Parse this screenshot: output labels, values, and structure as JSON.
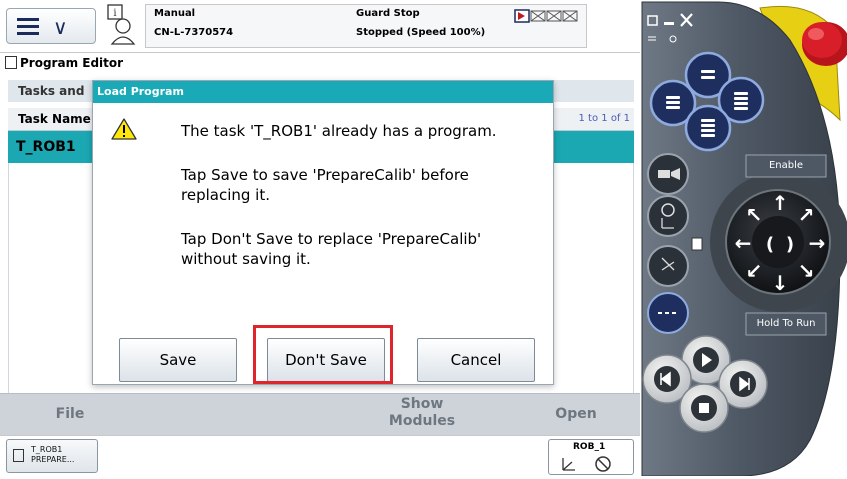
{
  "status_bar": {
    "mode": "Manual",
    "controller": "CN-L-7370574",
    "state": "Guard Stop",
    "speed": "Stopped (Speed 100%)"
  },
  "app": {
    "title": "Program Editor"
  },
  "tasks": {
    "header": "Tasks and",
    "column_header": "Task Name",
    "count": "1 to 1 of 1",
    "rows": [
      {
        "name": "T_ROB1"
      }
    ]
  },
  "dialog": {
    "title": "Load Program",
    "line1": "The task 'T_ROB1' already has a program.",
    "line2a": "Tap Save to save 'PrepareCalib' before",
    "line2b": "replacing it.",
    "line3a": "Tap Don't Save to replace 'PrepareCalib'",
    "line3b": "without saving it.",
    "buttons": {
      "save": "Save",
      "dont_save": "Don't Save",
      "cancel": "Cancel"
    },
    "icon": "warning-icon"
  },
  "bottom_toolbar": {
    "file": "File",
    "show_modules_1": "Show",
    "show_modules_2": "Modules",
    "open": "Open"
  },
  "taskbar": {
    "task_tab_line1": "T_ROB1",
    "task_tab_line2": "PREPARE...",
    "rob_tab": "ROB_1"
  },
  "pendant": {
    "enable": "Enable",
    "hold_to_run": "Hold To Run"
  },
  "colors": {
    "accent": "#1aaab7",
    "selection": "#1ba8b3",
    "highlight": "#e0242b",
    "pendant_body": "#5a6470",
    "estop": "#d81e28"
  }
}
